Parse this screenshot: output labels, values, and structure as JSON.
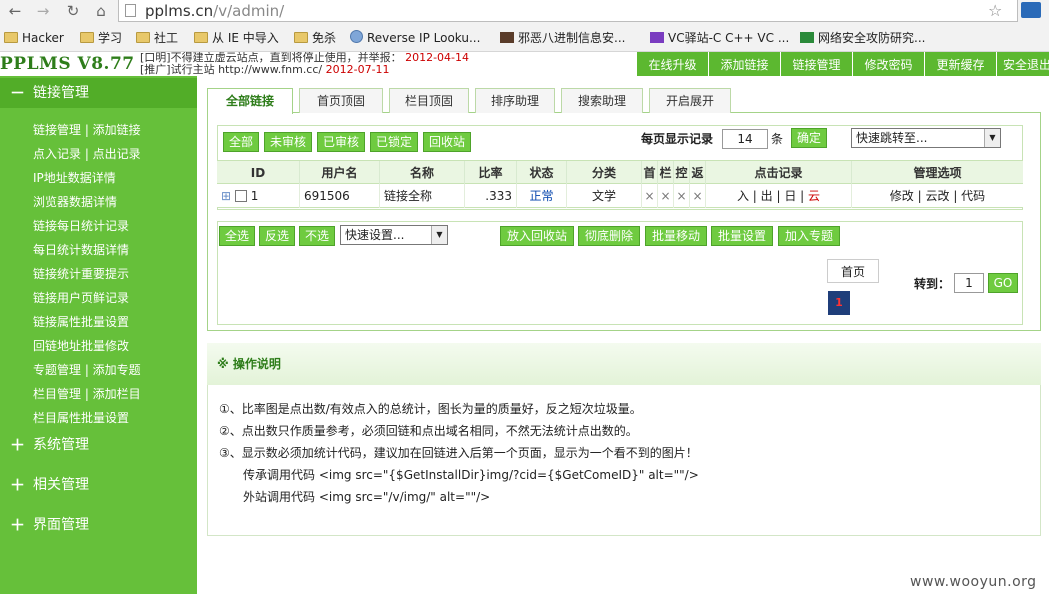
{
  "browser": {
    "url_host": "pplms.cn",
    "url_path": "/v/admin/",
    "bookmarks": [
      "Hacker",
      "学习",
      "社工",
      "从 IE 中导入",
      "免杀",
      "Reverse IP Looku...",
      "邪恶八进制信息安...",
      "VC驿站-C C++ VC ...",
      "网络安全攻防研究..."
    ]
  },
  "header": {
    "logo": "PPLMS V8.77",
    "ticker_line1": "[口明]不得建立虚云站点，直到将停止使用，并举报：",
    "ticker_date1": "2012-04-14",
    "ticker_line2": "[推广]试行主站 http://www.fnm.cc/",
    "ticker_date2": "2012-07-11",
    "top_menu": [
      "在线升级",
      "添加链接",
      "链接管理",
      "修改密码",
      "更新缓存",
      "安全退出"
    ]
  },
  "sidebar": {
    "sections": [
      {
        "label": "链接管理",
        "toggle": "－"
      },
      {
        "label": "系统管理",
        "toggle": "＋"
      },
      {
        "label": "相关管理",
        "toggle": "＋"
      },
      {
        "label": "界面管理",
        "toggle": "＋"
      }
    ],
    "items": [
      "链接管理 | 添加链接",
      "点入记录 | 点出记录",
      "IP地址数据详情",
      "浏览器数据详情",
      "链接每日统计记录",
      "每日统计数据详情",
      "链接统计重要提示",
      "链接用户页鲜记录",
      "链接属性批量设置",
      "回链地址批量修改",
      "专题管理 | 添加专题",
      "栏目管理 | 添加栏目",
      "栏目属性批量设置"
    ]
  },
  "tabs": [
    "全部链接",
    "首页顶固",
    "栏目顶固",
    "排序助理",
    "搜索助理",
    "开启展开"
  ],
  "filter": {
    "buttons": [
      "全部",
      "未审核",
      "已审核",
      "已锁定",
      "回收站"
    ],
    "per_page_label": "每页显示记录",
    "per_page_value": "14",
    "unit": "条",
    "confirm": "确定",
    "jump_select": "快速跳转至..."
  },
  "table": {
    "headers": [
      "ID",
      "用户名",
      "名称",
      "比率",
      "状态",
      "分类",
      "首",
      "栏",
      "控",
      "返",
      "点击记录",
      "管理选项"
    ],
    "row": {
      "expand": "⊞",
      "id": "1",
      "user": "691506",
      "name": "链接全称",
      "ratio": ".333",
      "status": "正常",
      "category": "文学",
      "flag1": "×",
      "flag2": "×",
      "flag3": "×",
      "flag4": "×",
      "click_in": "入",
      "click_out": "出",
      "click_day": "日",
      "click_cloud": "云",
      "edit": "修改",
      "cloud_edit": "云改",
      "code": "代码"
    }
  },
  "actions": {
    "select_all": "全选",
    "invert": "反选",
    "none": "不选",
    "quick_set": "快速设置...",
    "buttons": [
      "放入回收站",
      "彻底删除",
      "批量移动",
      "批量设置",
      "加入专题"
    ]
  },
  "pager": {
    "first": "首页",
    "current": "1",
    "goto_label": "转到：",
    "goto_value": "1",
    "go": "GO"
  },
  "notes": {
    "title": "操作说明",
    "marker": "※",
    "lines": [
      "①、比率图是点出数/有效点入的总统计，图长为量的质量好，反之短次垃圾量。",
      "②、点出数只作质量参考，必须回链和点出域名相同，不然无法统计点出数的。",
      "③、显示数必须加统计代码，建议加在回链进入后第一个页面，显示为一个看不到的图片！",
      "传承调用代码 <img src=\"{$GetInstallDir}img/?cid={$GetComeID}\" alt=\"\"/>",
      "外站调用代码 <img src=\"/v/img/\" alt=\"\"/>"
    ]
  },
  "watermark": "www.wooyun.org",
  "colors": {
    "sidebar": "#66c03a",
    "accent": "#5cb830",
    "link_status": "#0645ad",
    "cloud_red": "#c00"
  }
}
